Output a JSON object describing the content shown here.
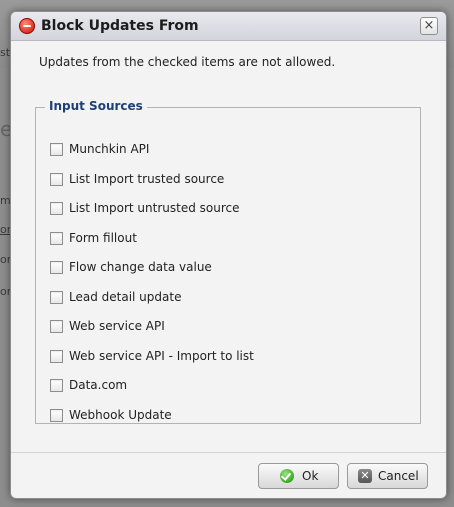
{
  "background": {
    "frags": [
      "st",
      "m",
      "or",
      "on",
      "on"
    ],
    "large_letter": "e"
  },
  "dialog": {
    "title": "Block Updates From",
    "close_glyph": "×",
    "description": "Updates from the checked items are not allowed.",
    "group_label": "Input Sources",
    "options": [
      {
        "label": "Munchkin API",
        "checked": false
      },
      {
        "label": "List Import trusted source",
        "checked": false
      },
      {
        "label": "List Import untrusted source",
        "checked": false
      },
      {
        "label": "Form fillout",
        "checked": false
      },
      {
        "label": "Flow change data value",
        "checked": false
      },
      {
        "label": "Lead detail update",
        "checked": false
      },
      {
        "label": "Web service API",
        "checked": false
      },
      {
        "label": "Web service API - Import to list",
        "checked": false
      },
      {
        "label": "Data.com",
        "checked": false
      },
      {
        "label": "Webhook Update",
        "checked": false
      }
    ],
    "buttons": {
      "ok": "Ok",
      "cancel": "Cancel"
    },
    "icons": {
      "title": "block-icon",
      "ok": "check-circle-icon",
      "cancel": "x-square-icon",
      "close": "close-icon"
    }
  }
}
